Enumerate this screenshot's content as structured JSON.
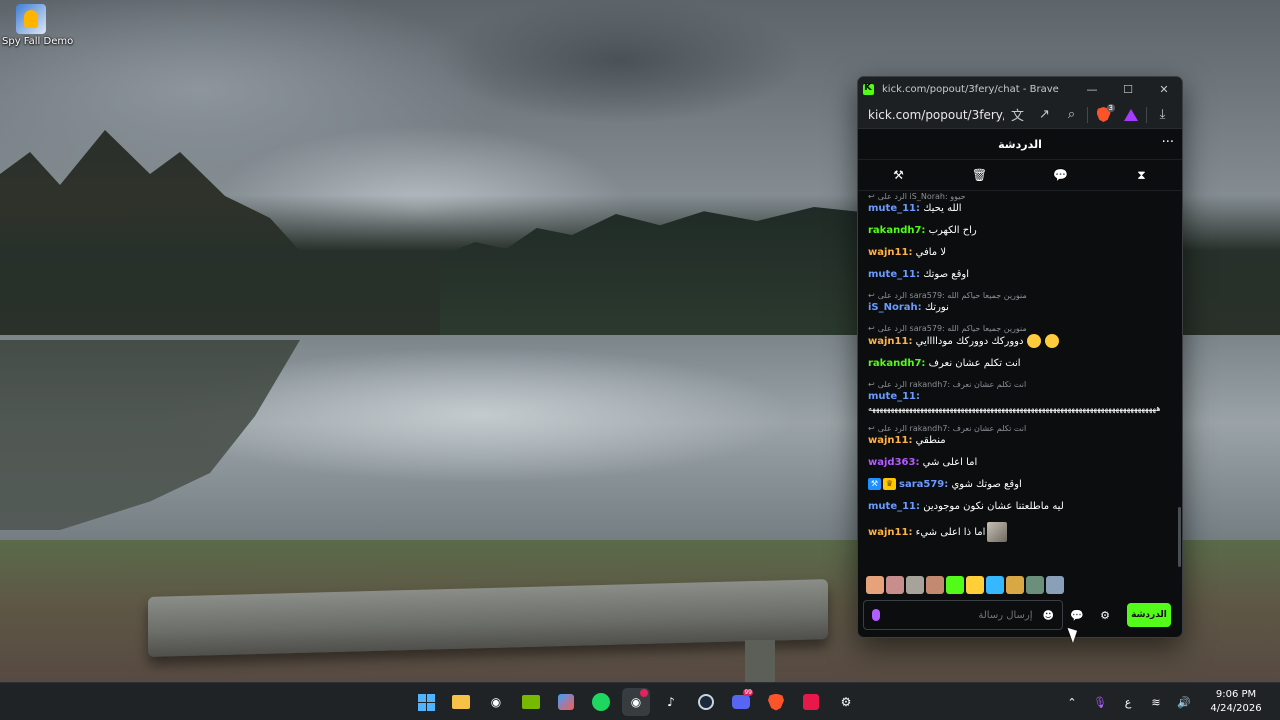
{
  "desktop": {
    "icon_label": "Spy Fall Demo"
  },
  "browser": {
    "title": "kick.com/popout/3fery/chat - Brave",
    "url": "kick.com/popout/3fery/...",
    "brave_badge": "3",
    "controls": {
      "minimize": "—",
      "maximize": "☐",
      "close": "✕"
    }
  },
  "chat": {
    "title": "الدردشة",
    "more": "···",
    "modbar": [
      "⚒",
      "🗑",
      "💬",
      "⧗"
    ],
    "messages": [
      {
        "reply_to": "الرد على iS_Norah: حيوو",
        "user": "mute_11:",
        "text": "الله يحيك",
        "color": "#6b9bff"
      },
      {
        "user": "rakandh7:",
        "text": "راح الكهرب",
        "color": "#53fc18"
      },
      {
        "user": "wajn11:",
        "text": "لا مافي",
        "color": "#ffb347"
      },
      {
        "user": "mute_11:",
        "text": "اوقع صوتك",
        "color": "#6b9bff"
      },
      {
        "reply_to": "الرد على sara579: منورين جميعا حياكم الله",
        "user": "iS_Norah:",
        "text": "نورتك",
        "color": "#6b9bff"
      },
      {
        "reply_to": "الرد على sara579: منورين جميعا حياكم الله",
        "user": "wajn11:",
        "text": "دووركك دووركك موداااايي",
        "color": "#ffb347",
        "emojis": 2
      },
      {
        "user": "rakandh7:",
        "text": "انت تكلم عشان نعرف",
        "color": "#53fc18"
      },
      {
        "reply_to": "الرد على rakandh7: انت تكلم عشان نعرف",
        "user": "mute_11:",
        "text": "",
        "color": "#6b9bff",
        "long": "ههههههههههههههههههههههههههههههههههههههههههههههههههههههههههههههههههههههههههههههه"
      },
      {
        "reply_to": "الرد على rakandh7: انت تكلم عشان نعرف",
        "user": "wajn11:",
        "text": "منطقي",
        "color": "#ffb347"
      },
      {
        "user": "wajd363:",
        "text": "اما اعلى شي",
        "color": "#b15cff"
      },
      {
        "user": "sara579:",
        "text": "اوقع صوتك شوي",
        "color": "#6b9bff",
        "badges": true
      },
      {
        "user": "mute_11:",
        "text": "ليه ماطلعتنا عشان نكون موجودين",
        "color": "#6b9bff"
      },
      {
        "user": "wajn11:",
        "text": "اما ذا اعلى شيء",
        "color": "#ffb347",
        "image": true
      }
    ],
    "emotes": [
      "#e6a27a",
      "#c88d8d",
      "#a8a39a",
      "#c48a6f",
      "#53fc18",
      "#ffcf3a",
      "#35b8ff",
      "#d9a845",
      "#6b8f7a",
      "#8aa0b8"
    ],
    "input_placeholder": "إرسال رسالة",
    "send_label": "الدردشة"
  },
  "taskbar": {
    "apps": [
      "start",
      "file-explorer",
      "obs",
      "nvidia",
      "store",
      "spotify",
      "obs-active",
      "tiktok",
      "steam",
      "discord",
      "brave",
      "affinity",
      "settings"
    ],
    "discord_badge": "99",
    "tray_lang": "ع",
    "time": "9:06 PM",
    "date": "4/24/2026"
  }
}
